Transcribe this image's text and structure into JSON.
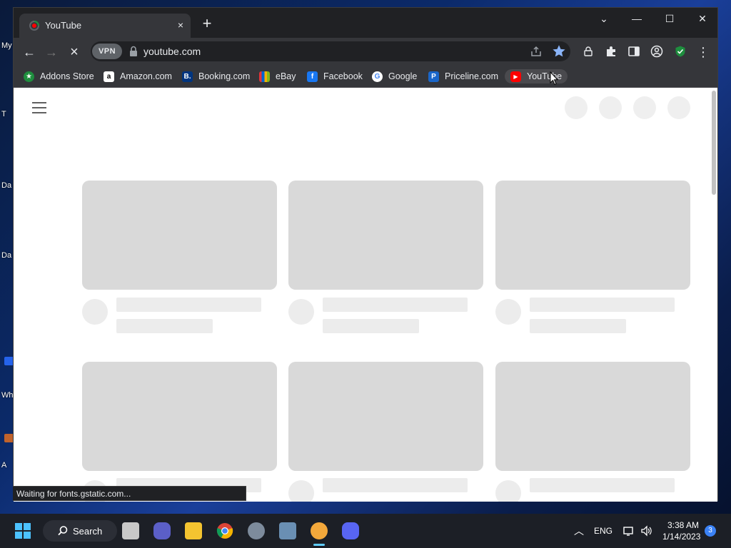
{
  "desktop": {
    "labels": [
      "My",
      "T",
      "Da",
      "Da",
      "Wh",
      "A"
    ]
  },
  "tab": {
    "title": "YouTube",
    "close_icon": "×",
    "new_tab_icon": "+"
  },
  "window_controls": {
    "search_tabs_icon": "⌄",
    "minimize_icon": "—",
    "maximize_icon": "☐",
    "close_icon": "✕"
  },
  "toolbar": {
    "back_icon": "←",
    "forward_icon": "→",
    "reload_icon": "×",
    "vpn_label": "VPN",
    "url": "youtube.com",
    "menu_icon": "⋮"
  },
  "bookmarks": [
    {
      "label": "Addons Store",
      "icon": "addons-store-icon",
      "color": "#1e8e3e"
    },
    {
      "label": "Amazon.com",
      "icon": "amazon-icon",
      "color": "#ffffff"
    },
    {
      "label": "Booking.com",
      "icon": "booking-icon",
      "color": "#003580"
    },
    {
      "label": "eBay",
      "icon": "ebay-icon",
      "color": "#e53238"
    },
    {
      "label": "Facebook",
      "icon": "facebook-icon",
      "color": "#1877f2"
    },
    {
      "label": "Google",
      "icon": "google-icon",
      "color": "#ffffff"
    },
    {
      "label": "Priceline.com",
      "icon": "priceline-icon",
      "color": "#1a66c9"
    },
    {
      "label": "YouTube",
      "icon": "youtube-icon",
      "color": "#ff0000"
    }
  ],
  "status": {
    "text": "Waiting for fonts.gstatic.com..."
  },
  "taskbar": {
    "search_label": "Search",
    "language": "ENG",
    "time": "3:38 AM",
    "date": "1/14/2023",
    "notification_count": "3"
  }
}
